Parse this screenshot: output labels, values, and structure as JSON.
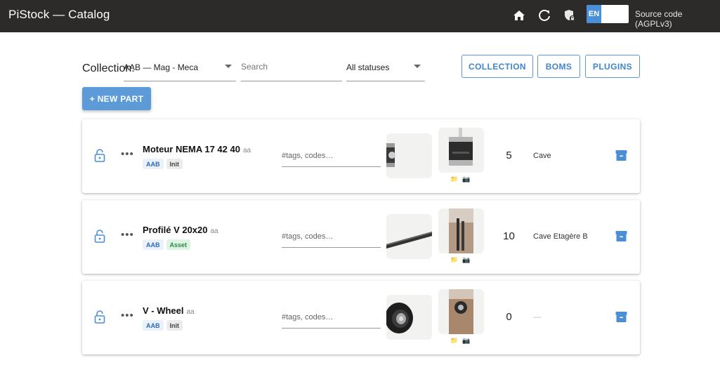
{
  "appbar": {
    "title": "PiStock — Catalog",
    "icons": [
      "home-icon",
      "refresh-icon",
      "shield-lock-icon"
    ],
    "lang_active": "EN",
    "lang_inactive": "",
    "source_link": "Source code (AGPLv3)"
  },
  "filters": {
    "collection_label": "Collection:",
    "collection_value": "AAB — Mag - Meca",
    "search_placeholder": "Search",
    "status_value": "All statuses"
  },
  "buttons": {
    "collection": "COLLECTION",
    "boms": "BOMS",
    "plugins": "PLUGINS",
    "new_part": "+ NEW PART"
  },
  "parts": [
    {
      "name": "Moteur NEMA 17 42 40",
      "suffix": "aa",
      "chips": [
        {
          "label": "AAB",
          "kind": "aab"
        },
        {
          "label": "Init",
          "kind": "init"
        }
      ],
      "tags_placeholder": "#tags, codes…",
      "quantity": "5",
      "location": "Cave"
    },
    {
      "name": "Profilé V 20x20",
      "suffix": "aa",
      "chips": [
        {
          "label": "AAB",
          "kind": "aab"
        },
        {
          "label": "Asset",
          "kind": "asset"
        }
      ],
      "tags_placeholder": "#tags, codes…",
      "quantity": "10",
      "location": "Cave Etagère B"
    },
    {
      "name": "V - Wheel",
      "suffix": "aa",
      "chips": [
        {
          "label": "AAB",
          "kind": "aab"
        },
        {
          "label": "Init",
          "kind": "init"
        }
      ],
      "tags_placeholder": "#tags, codes…",
      "quantity": "0",
      "location": "—"
    }
  ],
  "colors": {
    "appbar": "#2d2a2a",
    "accent": "#5c9ad8",
    "accent_text": "#3f85cf"
  }
}
